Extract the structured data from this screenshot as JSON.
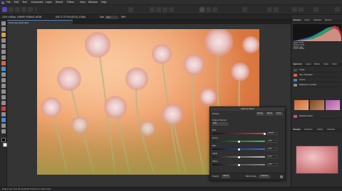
{
  "menu": {
    "items": [
      "File",
      "Edit",
      "Text",
      "Document",
      "Layer",
      "Select",
      "Filters",
      "View",
      "Window",
      "Help"
    ]
  },
  "context": {
    "doc_info": "1024 x 683px, 0.65MP, RGBA/8, sRGB",
    "camera": "DSC E 70 F5.6 (f/3.5), 1/160s",
    "size_label": "Size",
    "size_value": "64px",
    "zoom": "98%"
  },
  "document": {
    "tab_title": "bloom.jpg (Overview)"
  },
  "dialog": {
    "title": "Channel Mixer",
    "preset_label": "Presets",
    "buttons": [
      "Merge",
      "Reset",
      "Done"
    ],
    "channel_label": "Output Channel",
    "channel_value": "Red",
    "sliders": [
      {
        "name": "Red",
        "value": 100,
        "display": "100 %",
        "color": "#d83b3b"
      },
      {
        "name": "Green",
        "value": 0,
        "display": "0 %",
        "color": "#3bc95a"
      },
      {
        "name": "Blue",
        "value": 0,
        "display": "0 %",
        "color": "#3c6ee0"
      },
      {
        "name": "Alpha",
        "value": 0,
        "display": "0 %",
        "color": "#bcbcbc"
      },
      {
        "name": "Offset",
        "value": 0,
        "display": "0 %",
        "color": "#8a8a8a"
      }
    ],
    "opacity_label": "Opacity",
    "opacity_value": "100 %",
    "blend_label": "Blend Mode",
    "blend_value": "Normal"
  },
  "panels": {
    "top_tabs": [
      "Histogram",
      "Colour",
      "Swatches",
      "Brushes"
    ],
    "histogram_info": "Mean: 172.40\nStd Dev: 51.18\nMedian: 181\nPixels: 699392",
    "mid_tabs": [
      "Adjustment",
      "Layers",
      "Effects",
      "Styles",
      "Stock"
    ],
    "layers": [
      {
        "name": "Levels",
        "color": "#4a4a4a"
      },
      {
        "name": "Hue / Saturation",
        "color": "#d9663d"
      },
      {
        "name": "Curves",
        "color": "#5574c4"
      },
      {
        "name": "Brightness / Contrast",
        "color": "#888888"
      },
      {
        "name": "Selective Colour",
        "color": "#c45096"
      }
    ],
    "nav_tabs": [
      "Navigator",
      "Transform",
      "History",
      "Channels"
    ]
  },
  "status": {
    "text": "Drag to pan. Use the keyboard shortcuts to select tools."
  }
}
